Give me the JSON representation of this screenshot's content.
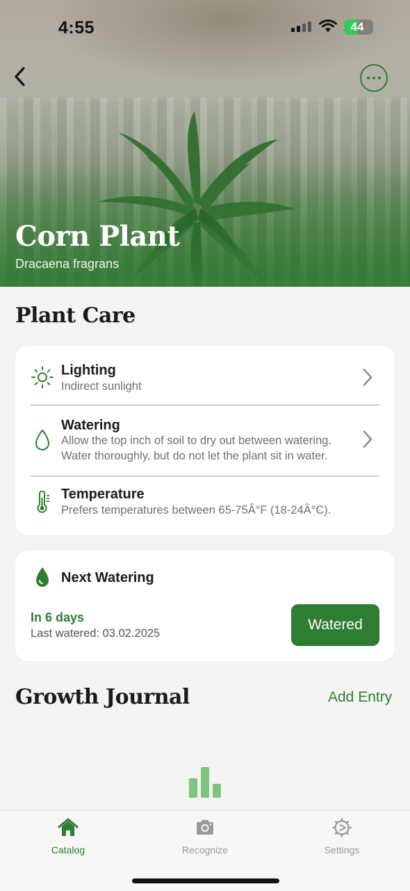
{
  "status_bar": {
    "time": "4:55",
    "battery": "44"
  },
  "plant": {
    "name": "Corn Plant",
    "scientific_name": "Dracaena fragrans"
  },
  "plant_care": {
    "title": "Plant Care",
    "items": [
      {
        "label": "Lighting",
        "description": "Indirect sunlight",
        "icon": "sun-icon",
        "has_chevron": true
      },
      {
        "label": "Watering",
        "description": "Allow the top inch of soil to dry out between watering. Water thoroughly, but do not let the plant sit in water.",
        "icon": "water-drop-outline-icon",
        "has_chevron": true
      },
      {
        "label": "Temperature",
        "description": "Prefers temperatures between 65-75Â°F (18-24Â°C).",
        "icon": "thermometer-icon",
        "has_chevron": false
      }
    ]
  },
  "next_watering": {
    "title": "Next Watering",
    "due": "In 6 days",
    "last_watered": "Last watered: 03.02.2025",
    "button_label": "Watered"
  },
  "growth_journal": {
    "title": "Growth Journal",
    "add_entry_label": "Add Entry"
  },
  "tab_bar": {
    "tabs": [
      {
        "label": "Catalog",
        "icon": "home-icon",
        "active": true
      },
      {
        "label": "Recognize",
        "icon": "camera-icon",
        "active": false
      },
      {
        "label": "Settings",
        "icon": "gear-icon",
        "active": false
      }
    ]
  },
  "colors": {
    "accent": "#2f7d32",
    "background": "#f4f5f2",
    "card": "#ffffff",
    "secondary_text": "#6f6f6f",
    "chart_placeholder": "#7dc47f"
  }
}
